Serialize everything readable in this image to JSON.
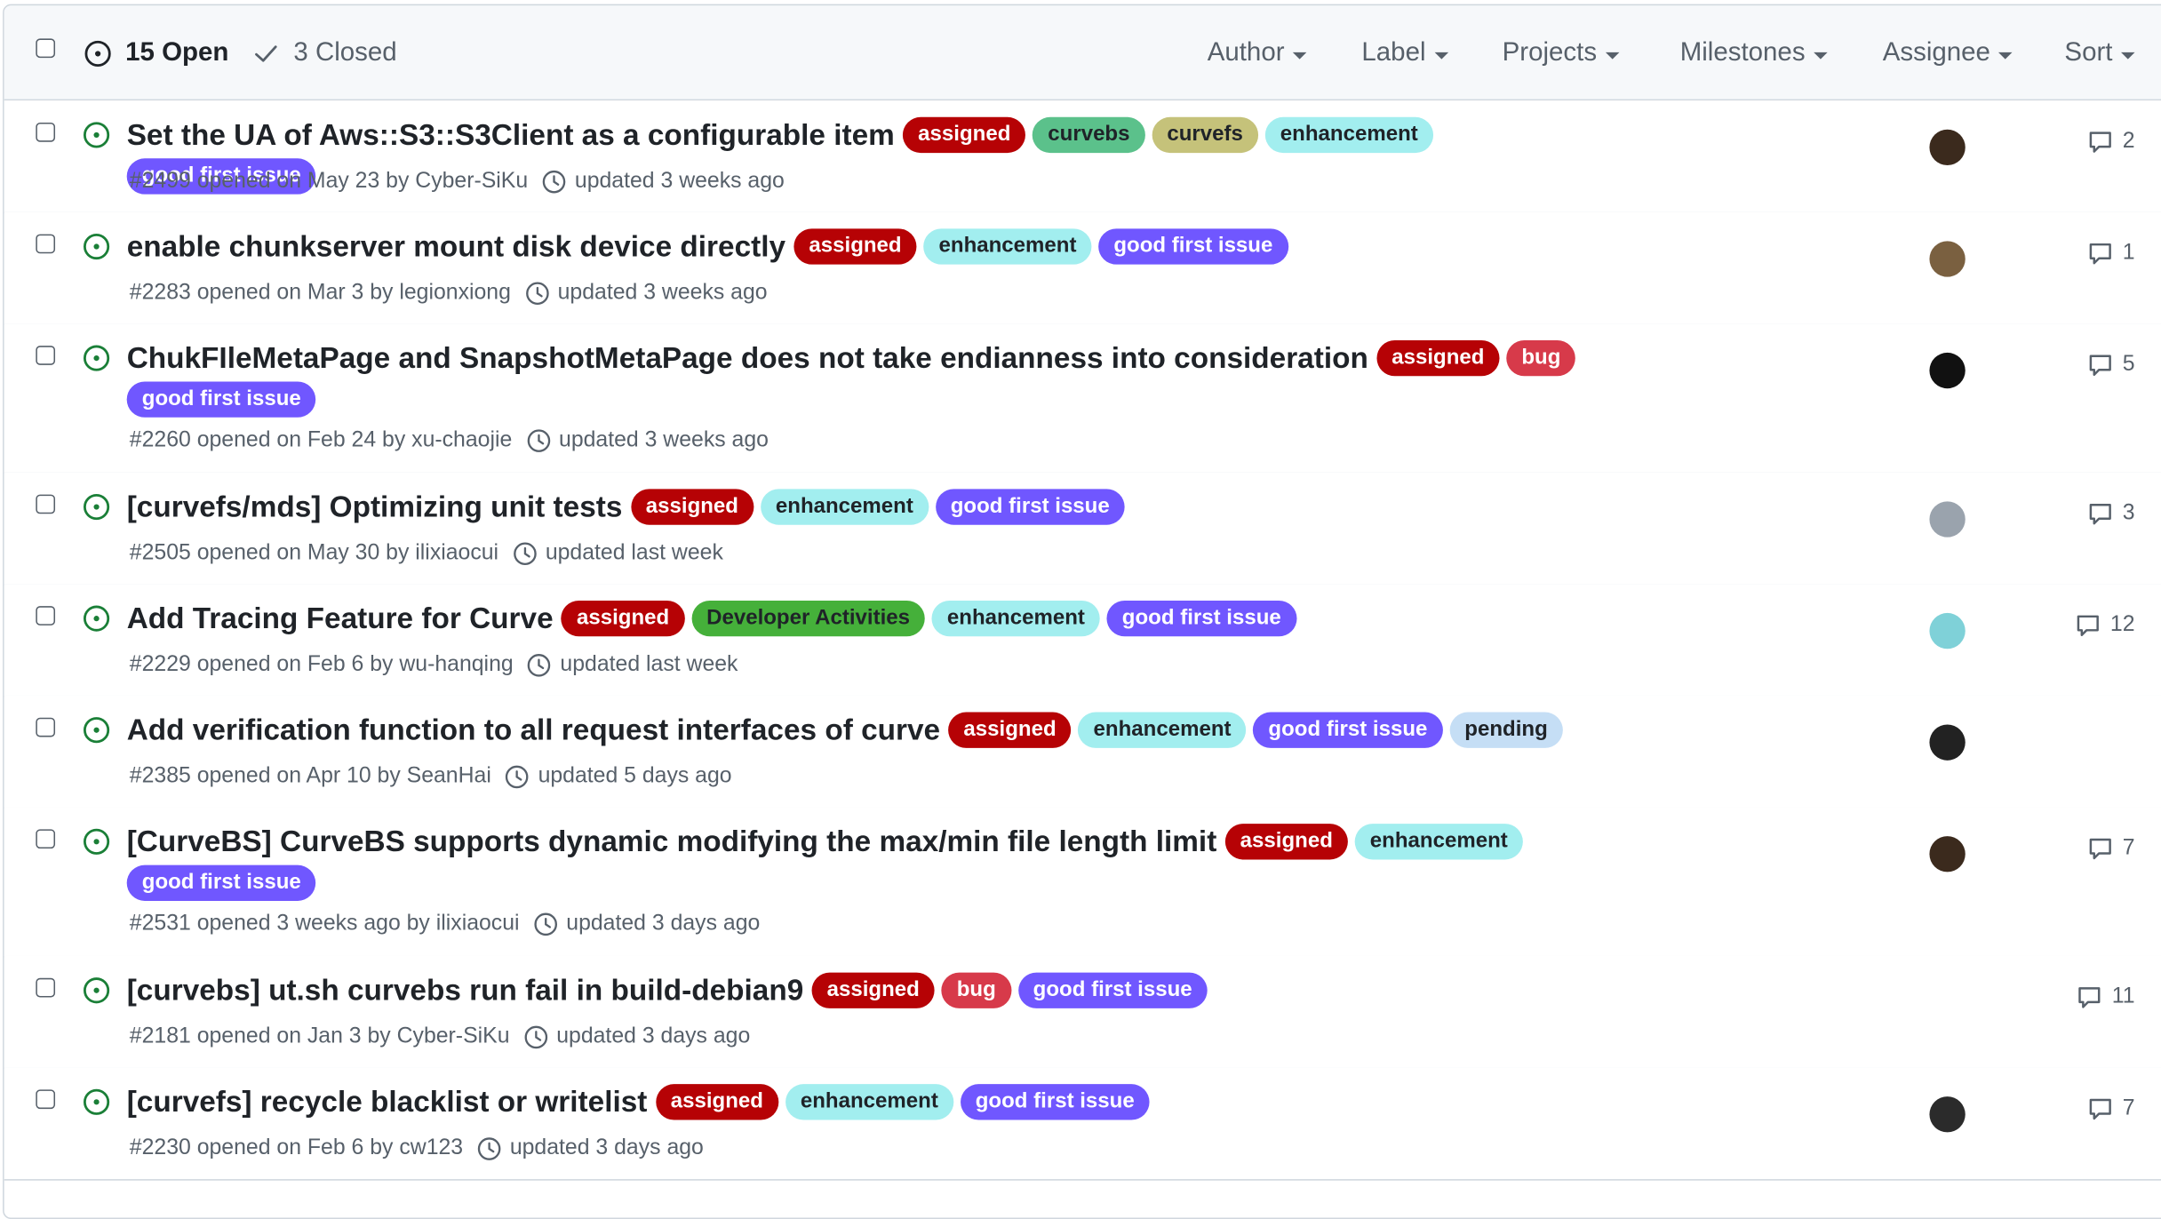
{
  "header": {
    "open_label": "15 Open",
    "closed_label": "3 Closed",
    "filters": [
      "Author",
      "Label",
      "Projects",
      "Milestones",
      "Assignee",
      "Sort"
    ]
  },
  "label_colors": {
    "assigned": {
      "bg": "#b60205",
      "fg": "#ffffff"
    },
    "curvebs": {
      "bg": "#5bc18b",
      "fg": "#1f2328"
    },
    "curvefs": {
      "bg": "#c5c27a",
      "fg": "#1f2328"
    },
    "enhancement": {
      "bg": "#a2eeef",
      "fg": "#1f2328"
    },
    "good first issue": {
      "bg": "#7057ff",
      "fg": "#ffffff"
    },
    "bug": {
      "bg": "#d73a4a",
      "fg": "#ffffff"
    },
    "Developer Activities": {
      "bg": "#45b03a",
      "fg": "#1f2328"
    },
    "pending": {
      "bg": "#c5def5",
      "fg": "#1f2328"
    }
  },
  "issues": [
    {
      "title": "Set the UA of Aws::S3::S3Client as a configurable item",
      "labels": [
        "assigned",
        "curvebs",
        "curvefs",
        "enhancement",
        "good first issue"
      ],
      "meta": "#2499 opened on May 23 by Cyber-SiKu",
      "updated": "updated 3 weeks ago",
      "comments": "2",
      "avatar_color": "#3b2a1d"
    },
    {
      "title": "enable chunkserver mount disk device directly",
      "labels": [
        "assigned",
        "enhancement",
        "good first issue"
      ],
      "meta": "#2283 opened on Mar 3 by legionxiong",
      "updated": "updated 3 weeks ago",
      "comments": "1",
      "avatar_color": "#7a6040"
    },
    {
      "title": "ChukFIleMetaPage and SnapshotMetaPage does not take endianness into consideration",
      "labels": [
        "assigned",
        "bug",
        "good first issue"
      ],
      "meta": "#2260 opened on Feb 24 by xu-chaojie",
      "updated": "updated 3 weeks ago",
      "comments": "5",
      "avatar_color": "#111111"
    },
    {
      "title": "[curvefs/mds] Optimizing unit tests",
      "labels": [
        "assigned",
        "enhancement",
        "good first issue"
      ],
      "meta": "#2505 opened on May 30 by ilixiaocui",
      "updated": "updated last week",
      "comments": "3",
      "avatar_color": "#9aa3ad"
    },
    {
      "title": "Add Tracing Feature for Curve",
      "labels": [
        "assigned",
        "Developer Activities",
        "enhancement",
        "good first issue"
      ],
      "meta": "#2229 opened on Feb 6 by wu-hanqing",
      "updated": "updated last week",
      "comments": "12",
      "avatar_color": "#7fd1d8"
    },
    {
      "title": "Add verification function to all request interfaces of curve",
      "labels": [
        "assigned",
        "enhancement",
        "good first issue",
        "pending"
      ],
      "meta": "#2385 opened on Apr 10 by SeanHai",
      "updated": "updated 5 days ago",
      "comments": "",
      "avatar_color": "#222222"
    },
    {
      "title": "[CurveBS] CurveBS supports dynamic modifying the max/min file length limit",
      "labels": [
        "assigned",
        "enhancement",
        "good first issue"
      ],
      "meta": "#2531 opened 3 weeks ago by ilixiaocui",
      "updated": "updated 3 days ago",
      "comments": "7",
      "avatar_color": "#3b2a1d"
    },
    {
      "title": "[curvebs] ut.sh curvebs run fail in build-debian9",
      "labels": [
        "assigned",
        "bug",
        "good first issue"
      ],
      "meta": "#2181 opened on Jan 3 by Cyber-SiKu",
      "updated": "updated 3 days ago",
      "comments": "11",
      "avatar_color": ""
    },
    {
      "title": "[curvefs] recycle blacklist or writelist",
      "labels": [
        "assigned",
        "enhancement",
        "good first issue"
      ],
      "meta": "#2230 opened on Feb 6 by cw123",
      "updated": "updated 3 days ago",
      "comments": "7",
      "avatar_color": "#2b2b2b"
    }
  ]
}
